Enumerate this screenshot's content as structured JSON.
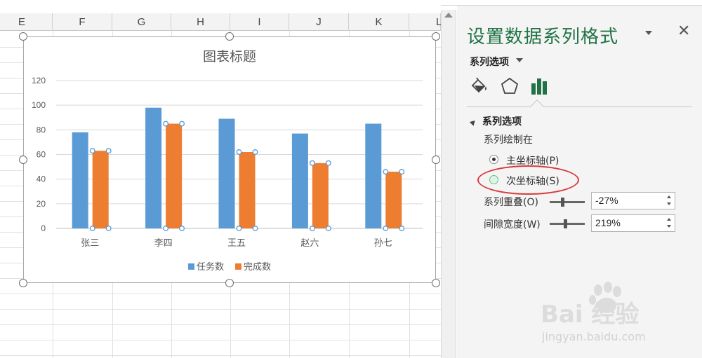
{
  "spreadsheet": {
    "columns": [
      "E",
      "F",
      "G",
      "H",
      "I",
      "J",
      "K",
      "L"
    ]
  },
  "chart_data": {
    "type": "bar",
    "title": "图表标题",
    "categories": [
      "张三",
      "李四",
      "王五",
      "赵六",
      "孙七"
    ],
    "series": [
      {
        "name": "任务数",
        "values": [
          78,
          98,
          89,
          77,
          85
        ],
        "color": "#5b9bd5"
      },
      {
        "name": "完成数",
        "values": [
          63,
          85,
          62,
          53,
          46
        ],
        "color": "#ed7d31"
      }
    ],
    "yticks": [
      "0",
      "20",
      "40",
      "60",
      "80",
      "100",
      "120"
    ],
    "ylim": [
      0,
      120
    ],
    "grid": true,
    "legend": "bottom",
    "selected_series": "完成数"
  },
  "pane": {
    "title": "设置数据系列格式",
    "series_options_menu": "系列选项",
    "section_title": "系列选项",
    "plot_series_on": "系列绘制在",
    "radio_primary": "主坐标轴(P)",
    "radio_secondary": "次坐标轴(S)",
    "overlap_label": "系列重叠(O)",
    "overlap_value": "-27%",
    "overlap_fraction": 0.365,
    "gap_label": "间隙宽度(W)",
    "gap_value": "219%",
    "gap_fraction": 0.44,
    "accent_color": "#217346",
    "icons": [
      "fill-line-icon",
      "effects-pentagon-icon",
      "series-bars-icon"
    ]
  },
  "watermark": {
    "brand": "Bai 经验",
    "url": "jingyan.baidu.com"
  }
}
